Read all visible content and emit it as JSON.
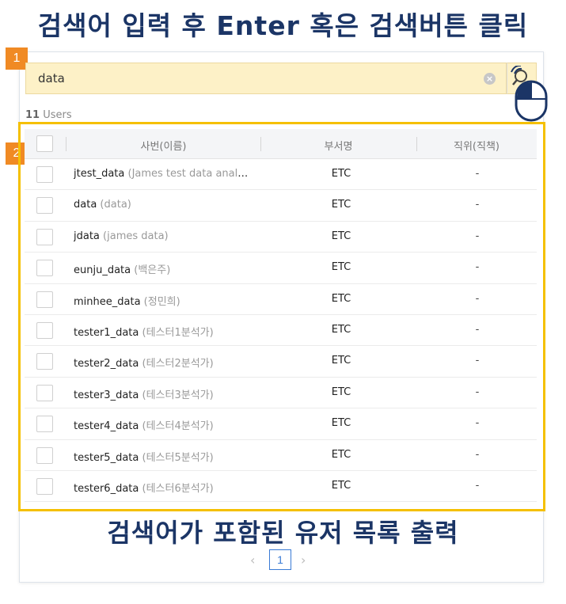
{
  "headings": {
    "top": "검색어 입력 후 Enter 혹은 검색버튼 클릭",
    "bottom": "검색어가 포함된 유저 목록 출력"
  },
  "badges": {
    "step1": "1",
    "step2": "2"
  },
  "search": {
    "value": "data",
    "clear_icon": "×"
  },
  "summary": {
    "count": "11",
    "label": " Users"
  },
  "table": {
    "headers": {
      "id": "사번(이름)",
      "dept": "부서명",
      "rank": "직위(직책)"
    },
    "rows": [
      {
        "id": "jtest_data",
        "name": " (James test data analyst)",
        "dept": "ETC",
        "rank": "-"
      },
      {
        "id": "data",
        "name": " (data)",
        "dept": "ETC",
        "rank": "-"
      },
      {
        "id": "jdata",
        "name": " (james data)",
        "dept": "ETC",
        "rank": "-"
      },
      {
        "id": "eunju_data",
        "name": " (백은주)",
        "dept": "ETC",
        "rank": "-"
      },
      {
        "id": "minhee_data",
        "name": " (정민희)",
        "dept": "ETC",
        "rank": "-"
      },
      {
        "id": "tester1_data",
        "name": " (테스터1분석가)",
        "dept": "ETC",
        "rank": "-"
      },
      {
        "id": "tester2_data",
        "name": " (테스터2분석가)",
        "dept": "ETC",
        "rank": "-"
      },
      {
        "id": "tester3_data",
        "name": " (테스터3분석가)",
        "dept": "ETC",
        "rank": "-"
      },
      {
        "id": "tester4_data",
        "name": " (테스터4분석가)",
        "dept": "ETC",
        "rank": "-"
      },
      {
        "id": "tester5_data",
        "name": " (테스터5분석가)",
        "dept": "ETC",
        "rank": "-"
      },
      {
        "id": "tester6_data",
        "name": " (테스터6분석가)",
        "dept": "ETC",
        "rank": "-"
      }
    ]
  },
  "pagination": {
    "prev": "‹",
    "current": "1",
    "next": "›"
  },
  "colors": {
    "heading": "#1b3566",
    "badge": "#f08a24",
    "highlight": "#f5c000",
    "search_bg": "#fdf1c7",
    "page_accent": "#3a7bd5"
  }
}
